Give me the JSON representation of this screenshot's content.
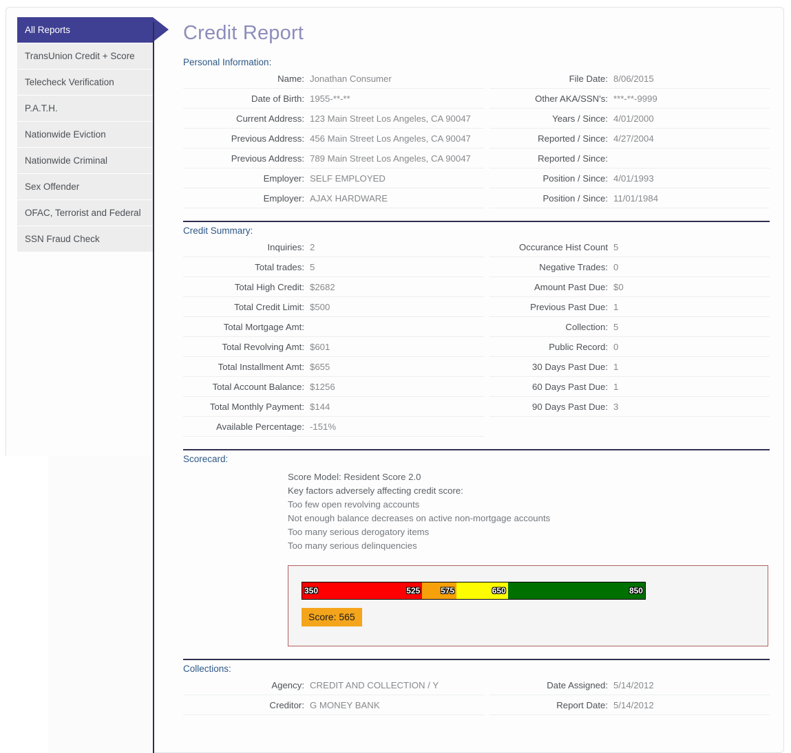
{
  "header": {
    "title": "Credit Report"
  },
  "sidebar": {
    "items": [
      {
        "label": "All Reports",
        "active": true
      },
      {
        "label": "TransUnion Credit + Score",
        "active": false
      },
      {
        "label": "Telecheck Verification",
        "active": false
      },
      {
        "label": "P.A.T.H.",
        "active": false
      },
      {
        "label": "Nationwide Eviction",
        "active": false
      },
      {
        "label": "Nationwide Criminal",
        "active": false
      },
      {
        "label": "Sex Offender",
        "active": false
      },
      {
        "label": "OFAC, Terrorist and Federal",
        "active": false
      },
      {
        "label": "SSN Fraud Check",
        "active": false
      }
    ]
  },
  "personal_information": {
    "heading": "Personal Information:",
    "rows": [
      {
        "l_label": "Name:",
        "l_value": "Jonathan Consumer",
        "r_label": "File Date:",
        "r_value": "8/06/2015"
      },
      {
        "l_label": "Date of Birth:",
        "l_value": "1955-**-**",
        "r_label": "Other AKA/SSN's:",
        "r_value": "***-**-9999"
      },
      {
        "l_label": "Current Address:",
        "l_value": "123 Main Street Los Angeles, CA 90047",
        "r_label": "Years / Since:",
        "r_value": "4/01/2000"
      },
      {
        "l_label": "Previous Address:",
        "l_value": "456 Main Street Los Angeles, CA 90047",
        "r_label": "Reported / Since:",
        "r_value": "4/27/2004"
      },
      {
        "l_label": "Previous Address:",
        "l_value": "789 Main Street Los Angeles, CA 90047",
        "r_label": "Reported / Since:",
        "r_value": ""
      },
      {
        "l_label": "Employer:",
        "l_value": "SELF EMPLOYED",
        "r_label": "Position / Since:",
        "r_value": "4/01/1993"
      },
      {
        "l_label": "Employer:",
        "l_value": "AJAX HARDWARE",
        "r_label": "Position / Since:",
        "r_value": "11/01/1984"
      }
    ]
  },
  "credit_summary": {
    "heading": "Credit Summary:",
    "rows": [
      {
        "l_label": "Inquiries:",
        "l_value": "2",
        "r_label": "Occurance Hist Count",
        "r_value": "5"
      },
      {
        "l_label": "Total trades:",
        "l_value": "5",
        "r_label": "Negative Trades:",
        "r_value": "0"
      },
      {
        "l_label": "Total High Credit:",
        "l_value": "$2682",
        "r_label": "Amount Past Due:",
        "r_value": "$0"
      },
      {
        "l_label": "Total Credit Limit:",
        "l_value": "$500",
        "r_label": "Previous Past Due:",
        "r_value": "1"
      },
      {
        "l_label": "Total Mortgage Amt:",
        "l_value": "",
        "r_label": "Collection:",
        "r_value": "5"
      },
      {
        "l_label": "Total Revolving Amt:",
        "l_value": "$601",
        "r_label": "Public Record:",
        "r_value": "0"
      },
      {
        "l_label": "Total Installment Amt:",
        "l_value": "$655",
        "r_label": "30 Days Past Due:",
        "r_value": "1"
      },
      {
        "l_label": "Total Account Balance:",
        "l_value": "$1256",
        "r_label": "60 Days Past Due:",
        "r_value": "1"
      },
      {
        "l_label": "Total Monthly Payment:",
        "l_value": "$144",
        "r_label": "90 Days Past Due:",
        "r_value": "3"
      },
      {
        "l_label": "Available Percentage:",
        "l_value": "-151%",
        "r_label": "",
        "r_value": ""
      }
    ]
  },
  "scorecard": {
    "heading": "Scorecard:",
    "score_model_line": "Score Model: Resident Score 2.0",
    "key_factors_line": "Key factors adversely affecting credit score:",
    "factors": [
      "Too few open revolving accounts",
      "Not enough balance decreases on active non-mortgage accounts",
      "Too many serious derogatory items",
      "Too many serious delinquencies"
    ],
    "gauge": {
      "min": 350,
      "max": 850,
      "segments": [
        {
          "from": "350",
          "to": "525",
          "color": "#fe0000"
        },
        {
          "from": "525",
          "to": "575",
          "color": "#f7a10a"
        },
        {
          "from": "575",
          "to": "650",
          "color": "#fdfc00"
        },
        {
          "from": "650",
          "to": "850",
          "color": "#007000"
        }
      ],
      "tick_350": "350",
      "tick_525": "525",
      "tick_575": "575",
      "tick_650": "650",
      "tick_850": "850"
    },
    "score_badge": "Score: 565"
  },
  "collections": {
    "heading": "Collections:",
    "rows": [
      {
        "l_label": "Agency:",
        "l_value": "CREDIT AND COLLECTION / Y",
        "r_label": "Date Assigned:",
        "r_value": "5/14/2012"
      },
      {
        "l_label": "Creditor:",
        "l_value": "G MONEY BANK",
        "r_label": "Report Date:",
        "r_value": "5/14/2012"
      }
    ]
  }
}
